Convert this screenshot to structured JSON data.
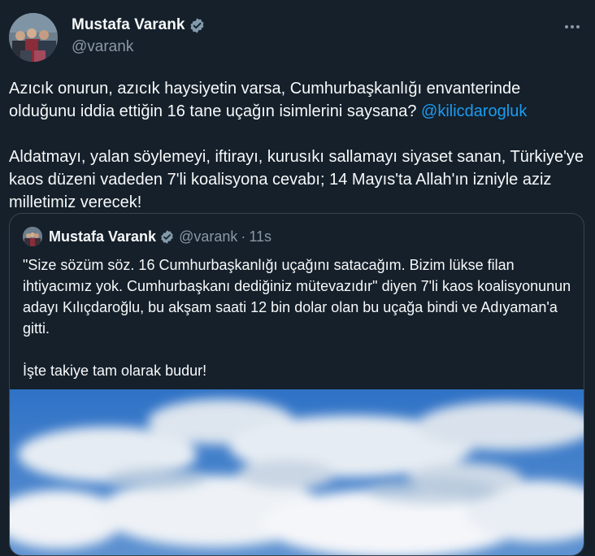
{
  "tweet": {
    "author_name": "Mustafa Varank",
    "author_handle": "@varank",
    "paragraph1_pre": "Azıcık onurun, azıcık haysiyetin varsa, Cumhurbaşkanlığı envanterinde olduğunu iddia ettiğin 16 tane uçağın isimlerini saysana? ",
    "paragraph1_mention": "@kilicdarogluk",
    "paragraph2": "Aldatmayı, yalan söylemeyi, iftirayı, kurusıkı sallamayı siyaset sanan, Türkiye'ye kaos düzeni vadeden 7'li koalisyona cevabı; 14 Mayıs'ta Allah'ın izniyle aziz milletimiz verecek!"
  },
  "quoted": {
    "author_name": "Mustafa Varank",
    "author_handle": "@varank",
    "separator": "·",
    "time": "11s",
    "paragraph1": "\"Size sözüm söz. 16 Cumhurbaşkanlığı uçağını satacağım. Bizim lükse filan ihtiyacımız yok. Cumhurbaşkanı dediğiniz mütevazıdır\" diyen 7'li kaos koalisyonunun adayı Kılıçdaroğlu, bu akşam saati 12 bin dolar olan bu uçağa bindi ve Adıyaman'a gitti.",
    "paragraph2": "İşte takiye tam olarak budur!"
  },
  "colors": {
    "background": "#15202b",
    "text": "#f7f9f9",
    "secondary": "#8b98a5",
    "accent": "#1d9bf0",
    "border": "#38444d"
  },
  "icons": {
    "verified": "verified-badge-icon",
    "more": "more-icon"
  }
}
